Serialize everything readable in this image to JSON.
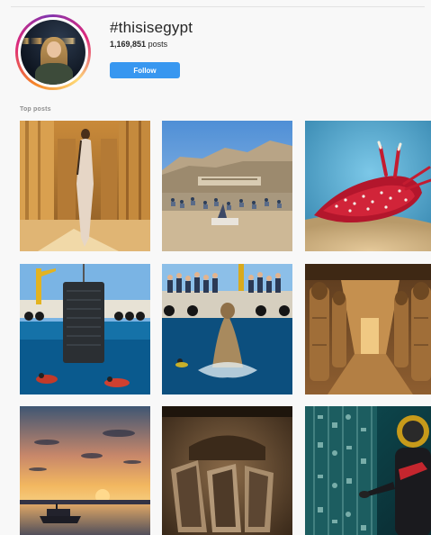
{
  "header": {
    "hashtag": "#thisisegypt",
    "post_count_value": "1,169,851",
    "post_count_suffix": "posts",
    "follow_label": "Follow"
  },
  "section": {
    "label": "Top posts"
  },
  "posts": [
    {
      "subject": "woman in gown among temple columns"
    },
    {
      "subject": "yoga group in front of desert temple"
    },
    {
      "subject": "red nudibranch on sea floor"
    },
    {
      "subject": "divers below boat raising stone"
    },
    {
      "subject": "crowd on boat lifting statue from water"
    },
    {
      "subject": "temple hall with carved statues"
    },
    {
      "subject": "boat on Nile at sunset"
    },
    {
      "subject": "stone sarcophagi in burial chamber"
    },
    {
      "subject": "diver touching hieroglyph wall"
    }
  ],
  "colors": {
    "follow_button": "#3897f0",
    "background": "#f8f8f8",
    "text": "#262626",
    "muted": "#8e8e8e"
  }
}
